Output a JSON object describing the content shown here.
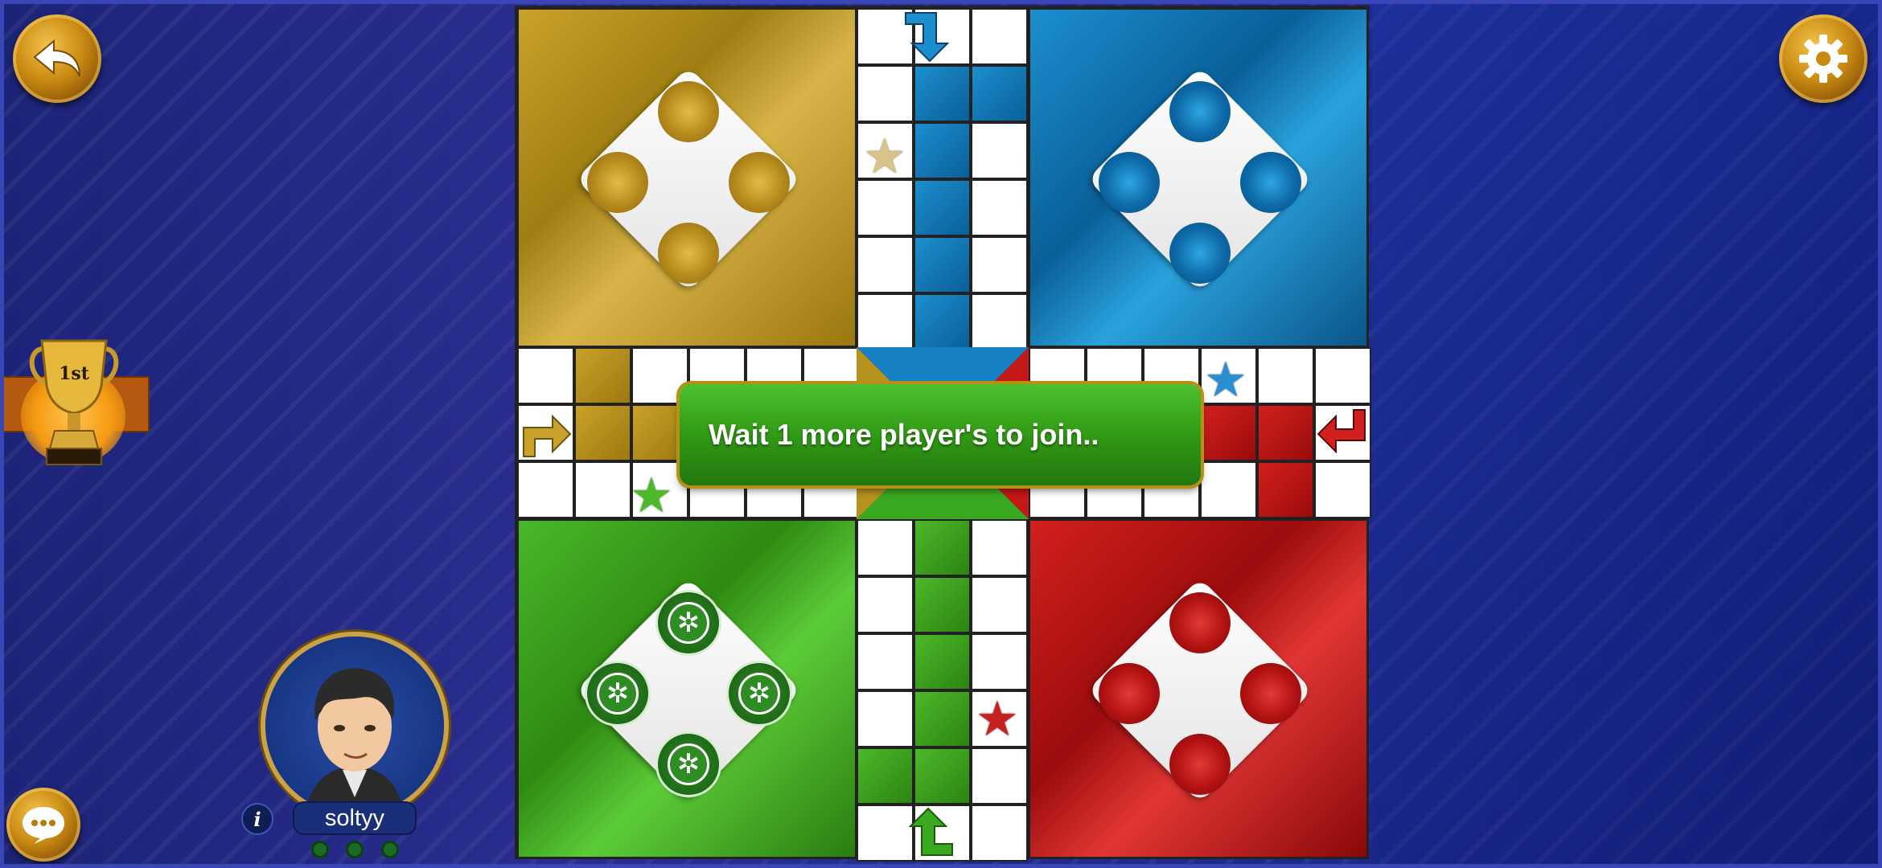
{
  "hud": {
    "back_icon": "back-arrow-icon",
    "settings_icon": "gear-icon",
    "chat_icon": "chat-bubble-icon"
  },
  "trophy": {
    "rank_label": "1st"
  },
  "board": {
    "colors": {
      "yellow": "#c9a22a",
      "blue": "#1b8fce",
      "green": "#46b52a",
      "red": "#d2201e"
    }
  },
  "banner": {
    "message": "Wait 1 more player's to join.."
  },
  "player": {
    "name": "soltyy",
    "info_label": "i",
    "dots": 3
  }
}
